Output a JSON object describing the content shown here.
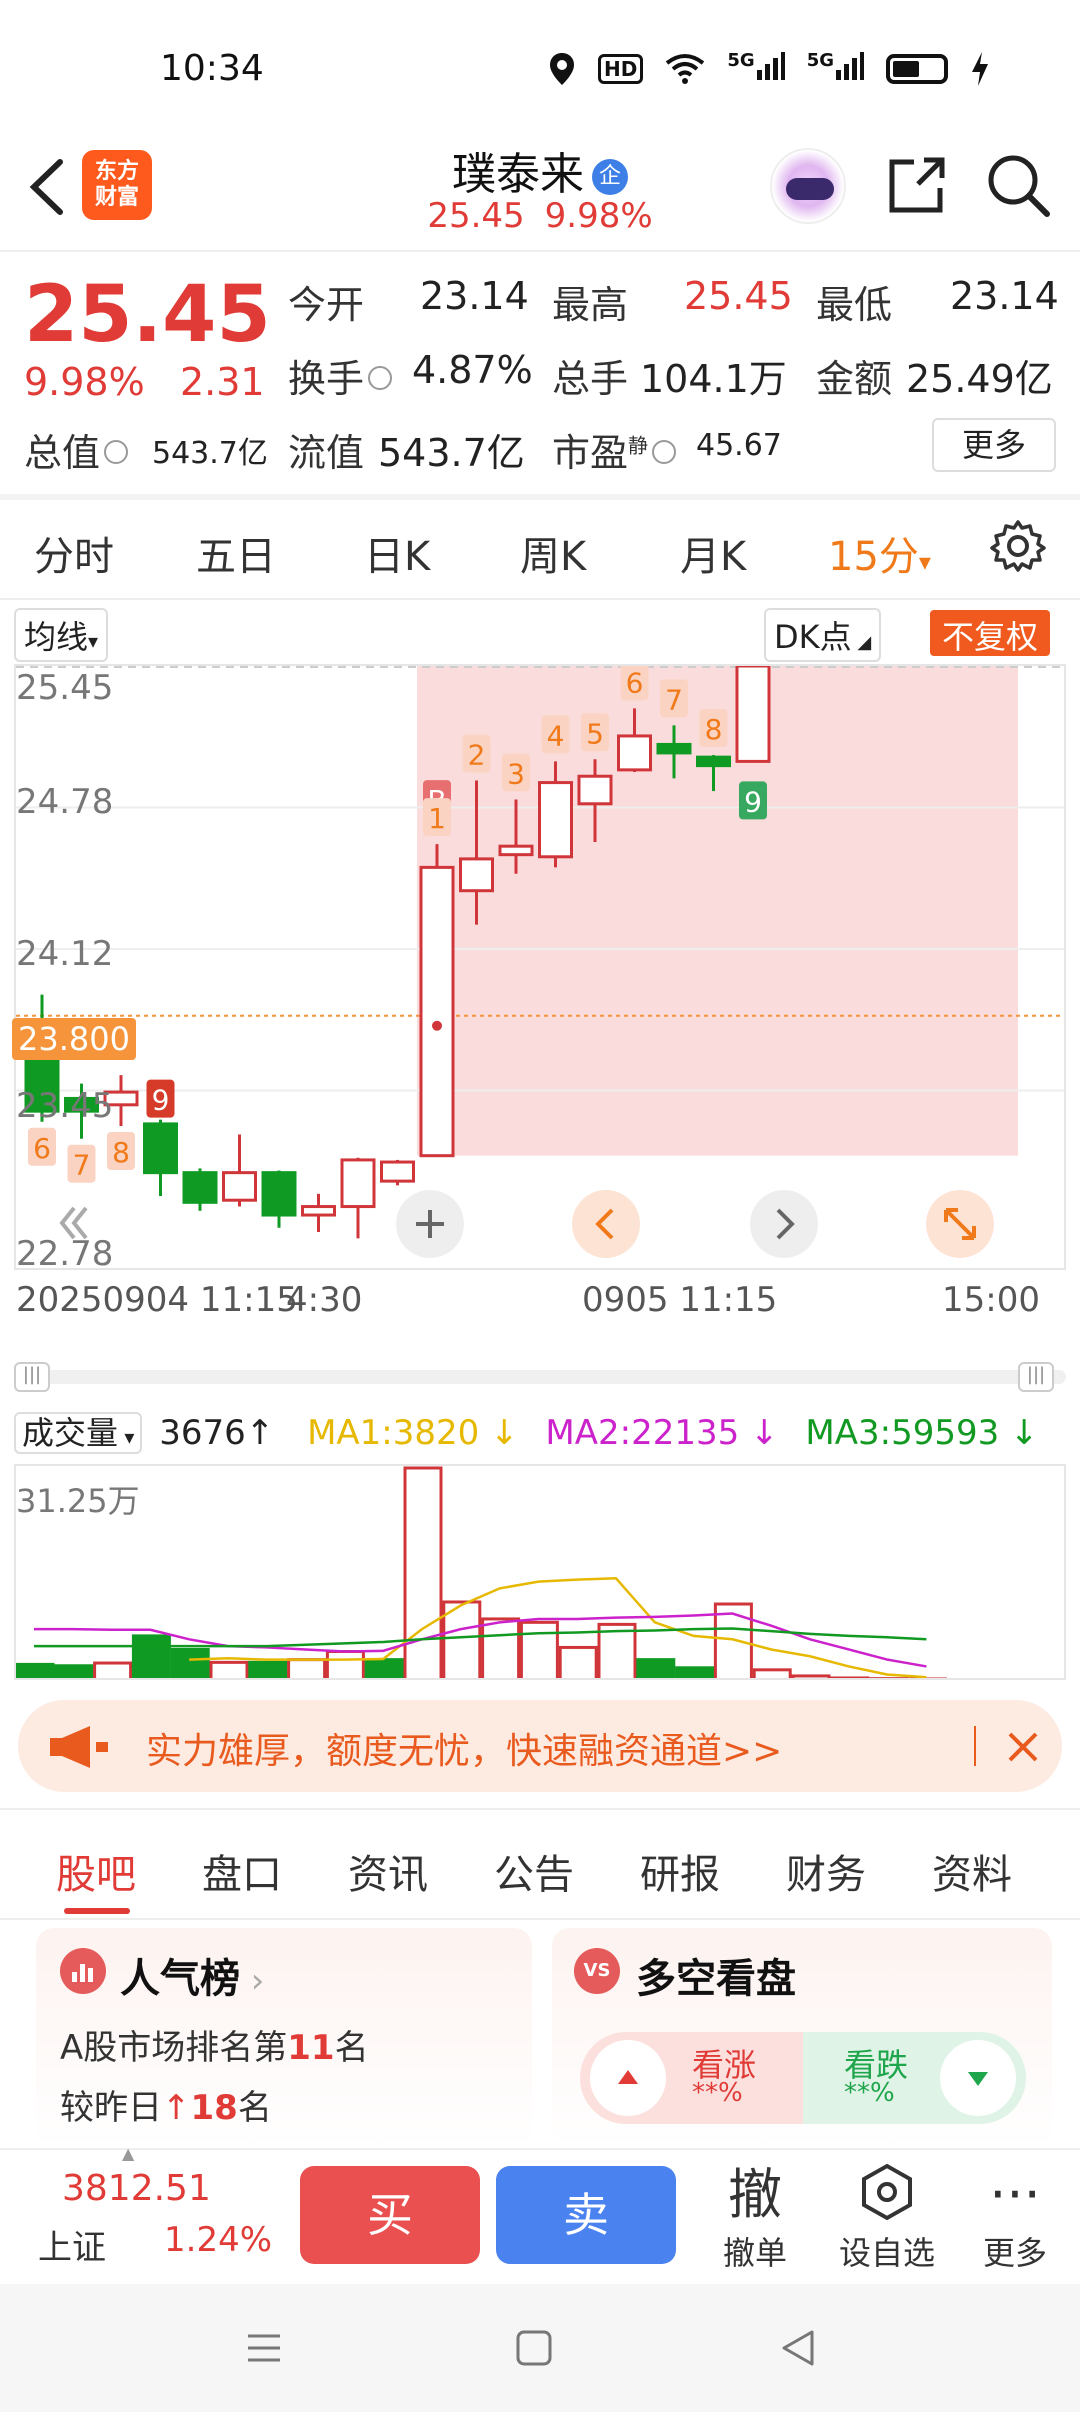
{
  "status_bar": {
    "time": "10:34",
    "network_hd": "HD",
    "network_5g_1": "5G",
    "network_5g_2": "5G"
  },
  "header": {
    "logo_line1": "东方",
    "logo_line2": "财富",
    "title": "璞泰来",
    "title_badge": "企",
    "price": "25.45",
    "change_pct": "9.98%"
  },
  "quote": {
    "price": "25.45",
    "change_pct": "9.98%",
    "change_abs": "2.31",
    "open_label": "今开",
    "open_value": "23.14",
    "high_label": "最高",
    "high_value": "25.45",
    "low_label": "最低",
    "low_value": "23.14",
    "turnover_label": "换手",
    "turnover_value": "4.87%",
    "volume_label": "总手",
    "volume_value": "104.1万",
    "amount_label": "金额",
    "amount_value": "25.49亿",
    "mktcap_label": "总值",
    "mktcap_value": "543.7亿",
    "float_label": "流值",
    "float_value": "543.7亿",
    "pe_label": "市盈",
    "pe_sup": "静",
    "pe_value": "45.67",
    "more_label": "更多"
  },
  "period_tabs": [
    "分时",
    "五日",
    "日K",
    "周K",
    "月K",
    "15分"
  ],
  "period_active_caret": "▾",
  "chart_toolbar": {
    "indicator_select": "均线",
    "dk_label": "DK点",
    "adjust_label": "不复权"
  },
  "chart_data": {
    "type": "candlestick",
    "y_ticks": [
      "25.45",
      "24.78",
      "24.12",
      "23.45",
      "22.78"
    ],
    "ylim": [
      22.78,
      25.45
    ],
    "reference_price": "23.800",
    "x_ticks": [
      "20250904 11:15",
      "4:30",
      "0905 11:15",
      "15:00"
    ],
    "candles": [
      {
        "o": 23.66,
        "c": 23.35,
        "h": 23.9,
        "l": 23.3
      },
      {
        "o": 23.41,
        "c": 23.35,
        "h": 23.48,
        "l": 23.22
      },
      {
        "o": 23.38,
        "c": 23.44,
        "h": 23.52,
        "l": 23.28
      },
      {
        "o": 23.29,
        "c": 23.06,
        "h": 23.31,
        "l": 22.95
      },
      {
        "o": 23.06,
        "c": 22.92,
        "h": 23.08,
        "l": 22.88
      },
      {
        "o": 22.93,
        "c": 23.06,
        "h": 23.24,
        "l": 22.9
      },
      {
        "o": 23.06,
        "c": 22.86,
        "h": 23.07,
        "l": 22.8
      },
      {
        "o": 22.86,
        "c": 22.9,
        "h": 22.96,
        "l": 22.78
      },
      {
        "o": 22.9,
        "c": 23.12,
        "h": 23.13,
        "l": 22.75
      },
      {
        "o": 23.02,
        "c": 23.11,
        "h": 23.12,
        "l": 23.0
      },
      {
        "o": 23.14,
        "c": 24.5,
        "h": 24.61,
        "l": 23.14
      },
      {
        "o": 24.39,
        "c": 24.54,
        "h": 24.91,
        "l": 24.23
      },
      {
        "o": 24.56,
        "c": 24.6,
        "h": 24.82,
        "l": 24.47
      },
      {
        "o": 24.55,
        "c": 24.9,
        "h": 25.0,
        "l": 24.5
      },
      {
        "o": 24.8,
        "c": 24.93,
        "h": 25.01,
        "l": 24.62
      },
      {
        "o": 24.96,
        "c": 25.12,
        "h": 25.25,
        "l": 24.95
      },
      {
        "o": 25.08,
        "c": 25.04,
        "h": 25.17,
        "l": 24.92
      },
      {
        "o": 25.02,
        "c": 24.98,
        "h": 25.03,
        "l": 24.86
      },
      {
        "o": 25.0,
        "c": 25.45,
        "h": 25.45,
        "l": 25.0
      }
    ],
    "signals": [
      {
        "i": 10,
        "label": "B"
      },
      {
        "i": 10,
        "label": "1"
      },
      {
        "i": 11,
        "label": "2"
      },
      {
        "i": 12,
        "label": "3"
      },
      {
        "i": 13,
        "label": "4"
      },
      {
        "i": 14,
        "label": "5"
      },
      {
        "i": 15,
        "label": "6"
      },
      {
        "i": 16,
        "label": "7"
      },
      {
        "i": 17,
        "label": "8"
      },
      {
        "i": 18,
        "label": "9"
      },
      {
        "i": 0,
        "label": "6"
      },
      {
        "i": 1,
        "label": "7"
      },
      {
        "i": 2,
        "label": "8"
      },
      {
        "i": 3,
        "label": "9"
      }
    ],
    "colors": {
      "up": "#d0353a",
      "down": "#0f9b23",
      "highlight": "#fbdcdc",
      "ref_line": "#f5943a"
    }
  },
  "volume": {
    "selector": "成交量",
    "value": "3676",
    "arrow": "↑",
    "ma1": "MA1:3820",
    "ma2": "MA2:22135",
    "ma3": "MA3:59593",
    "ma_arrow": "↓",
    "y_max_label": "31.25万",
    "colors": {
      "ma1": "#e6b800",
      "ma2": "#cc22cc",
      "ma3": "#119922"
    },
    "bars": [
      {
        "v": 2.3,
        "up": false
      },
      {
        "v": 2.1,
        "up": false
      },
      {
        "v": 2.5,
        "up": true
      },
      {
        "v": 6.5,
        "up": false
      },
      {
        "v": 4.5,
        "up": false
      },
      {
        "v": 2.6,
        "up": true
      },
      {
        "v": 2.6,
        "up": false
      },
      {
        "v": 3.0,
        "up": true
      },
      {
        "v": 4.2,
        "up": true
      },
      {
        "v": 3.0,
        "up": false
      },
      {
        "v": 31.25,
        "up": true
      },
      {
        "v": 11.5,
        "up": true
      },
      {
        "v": 9.0,
        "up": true
      },
      {
        "v": 8.5,
        "up": true
      },
      {
        "v": 4.8,
        "up": true
      },
      {
        "v": 8.2,
        "up": true
      },
      {
        "v": 3.0,
        "up": false
      },
      {
        "v": 1.8,
        "up": false
      },
      {
        "v": 11.2,
        "up": true
      },
      {
        "v": 1.5,
        "up": true
      },
      {
        "v": 0.6,
        "up": true
      },
      {
        "v": 0.3,
        "up": true
      },
      {
        "v": 0.2,
        "up": true
      },
      {
        "v": 0.15,
        "up": true
      }
    ],
    "ma1_line": [
      null,
      null,
      null,
      null,
      3.0,
      3.2,
      3.0,
      3.0,
      3.0,
      3.1,
      7.5,
      11,
      13.5,
      14.5,
      14.8,
      15,
      8.5,
      6.5,
      6.0,
      4.5,
      3.5,
      2.0,
      0.8,
      0.4
    ],
    "ma2_line": [
      7.5,
      7.5,
      7.4,
      7.4,
      6.0,
      5.0,
      4.8,
      4.5,
      4.2,
      4.3,
      6.0,
      7.5,
      8.5,
      9.0,
      9.0,
      9.2,
      9.3,
      9.5,
      9.8,
      8.0,
      6.0,
      4.5,
      3.0,
      2.0
    ],
    "ma3_line": [
      5.0,
      5.0,
      5.0,
      5.0,
      5.0,
      5.0,
      5.0,
      5.2,
      5.4,
      5.6,
      6.0,
      6.3,
      6.6,
      6.9,
      7.0,
      7.2,
      7.3,
      7.5,
      7.6,
      7.2,
      6.8,
      6.5,
      6.3,
      6.0
    ]
  },
  "banner": {
    "text": "实力雄厚，额度无忧，快速融资通道>>"
  },
  "section_tabs": [
    "股吧",
    "盘口",
    "资讯",
    "公告",
    "研报",
    "财务",
    "资料"
  ],
  "cards": {
    "popularity": {
      "title": "人气榜",
      "line1_prefix": "A股市场排名第",
      "line1_num": "11",
      "line1_suffix": "名",
      "line2_prefix": "较昨日",
      "line2_num": "18",
      "line2_suffix": "名"
    },
    "sentiment": {
      "icon": "VS",
      "title": "多空看盘",
      "bull_label": "看涨",
      "bull_value": "**%",
      "bear_label": "看跌",
      "bear_value": "**%"
    }
  },
  "bottom_bar": {
    "index_value": "3812.51",
    "index_name": "上证",
    "index_change": "1.24%",
    "buy": "买",
    "sell": "卖",
    "cancel_icon": "撤",
    "cancel_label": "撤单",
    "watch_label": "设自选",
    "more_label": "更多"
  }
}
